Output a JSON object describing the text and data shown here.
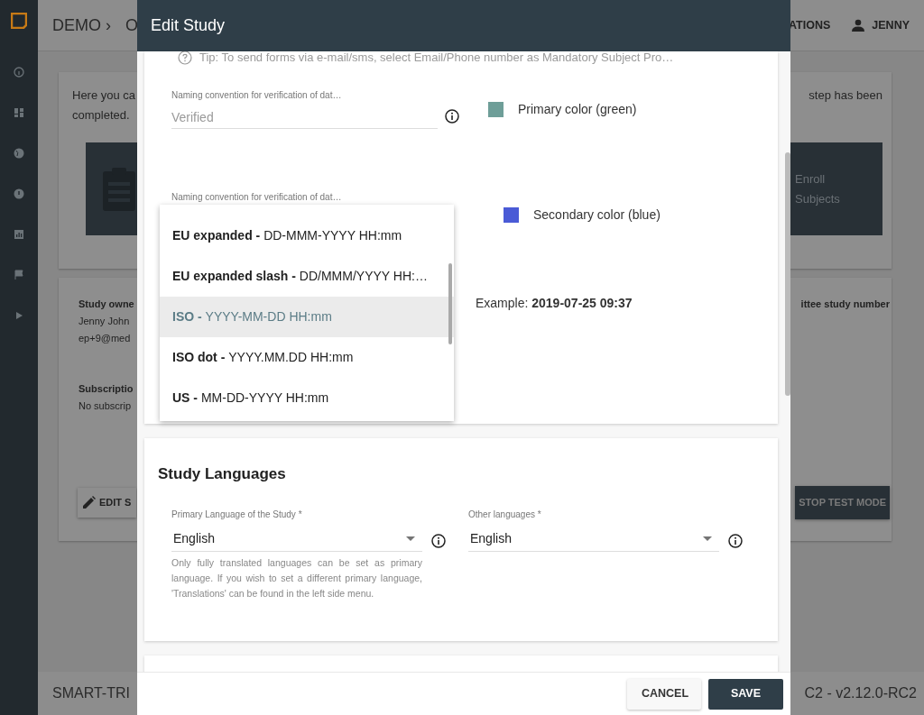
{
  "topbar": {
    "breadcrumb": "DEMO ›",
    "crumb_2": "O",
    "menu_item": "ATIONS",
    "user": "JENNY"
  },
  "background": {
    "intro_left": [
      "Here you ca",
      "completed."
    ],
    "intro_right": "step has been",
    "tile_right": [
      "Enroll",
      "Subjects"
    ],
    "owner_label": "Study owne",
    "owner_lines": [
      "Jenny John",
      "ep+9@med"
    ],
    "subscription_label": "Subscriptio",
    "subscription_value": "No subscrip",
    "right_label": "ittee study number",
    "edit_button": "EDIT S",
    "stop_button": "STOP TEST MODE"
  },
  "footer": {
    "left": "SMART-TRI",
    "right": "C2 - v2.12.0-RC2"
  },
  "modal": {
    "title": "Edit Study",
    "tip": "Tip: To send forms via e-mail/sms, select Email/Phone number as Mandatory Subject Pro…",
    "fields": [
      {
        "label": "Naming convention for verification of dat…",
        "placeholder": "Verified"
      },
      {
        "label": "Naming convention for verification of dat…"
      }
    ],
    "colors": [
      {
        "label": "Primary color (green)",
        "color": "#6e9e98"
      },
      {
        "label": "Secondary color (blue)",
        "color": "#4a5bd6"
      }
    ],
    "date_format": {
      "example": "Example: **2019-07-25 09:37**",
      "options": [
        {
          "name": "EU expanded -",
          "format": "DD-MMM-YYYY HH:mm",
          "selected": false
        },
        {
          "name": "EU expanded slash -",
          "format": "DD/MMM/YYYY HH:…",
          "selected": false
        },
        {
          "name": "ISO -",
          "format": "YYYY-MM-DD HH:mm",
          "selected": true
        },
        {
          "name": "ISO dot -",
          "format": "YYYY.MM.DD HH:mm",
          "selected": false
        },
        {
          "name": "US -",
          "format": "MM-DD-YYYY HH:mm",
          "selected": false
        }
      ]
    },
    "languages": {
      "title": "Study Languages",
      "primary": {
        "label": "Primary Language of the Study *",
        "value": "English",
        "hint": "Only fully translated languages can be set as primary language. If you wish to set a different primary language, 'Translations' can be found in the left side menu."
      },
      "other": {
        "label": "Other languages *",
        "value": "English"
      }
    },
    "buttons": [
      {
        "label": "CANCEL",
        "kind": "secondary"
      },
      {
        "label": "SAVE",
        "kind": "primary"
      }
    ]
  }
}
